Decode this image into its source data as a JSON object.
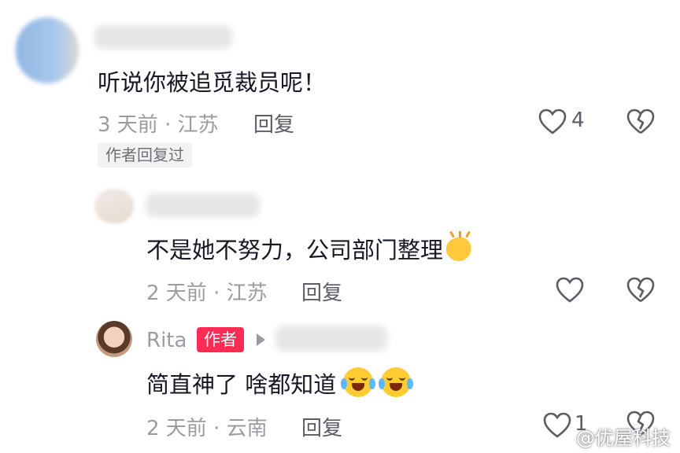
{
  "comments": [
    {
      "text": "听说你被追觅裁员呢！",
      "time_location": "3 天前 · 江苏",
      "reply_label": "回复",
      "likes": "4",
      "author_replied_tag": "作者回复过"
    },
    {
      "text": "不是她不努力，公司部门整理",
      "time_location": "2 天前 · 江苏",
      "reply_label": "回复",
      "likes": ""
    },
    {
      "author_name": "Rita",
      "author_badge": "作者",
      "text": "简直神了 啥都知道",
      "time_location": "2 天前 · 云南",
      "reply_label": "回复",
      "likes": "1"
    }
  ],
  "watermark": "@优屋科技",
  "icons": {
    "like": "heart-outline-icon",
    "dislike": "broken-heart-icon",
    "reply_arrow": "play-arrow-icon",
    "clap_emoji": "clapping-hands-emoji",
    "laugh_cry_emoji": "tears-of-joy-emoji"
  }
}
